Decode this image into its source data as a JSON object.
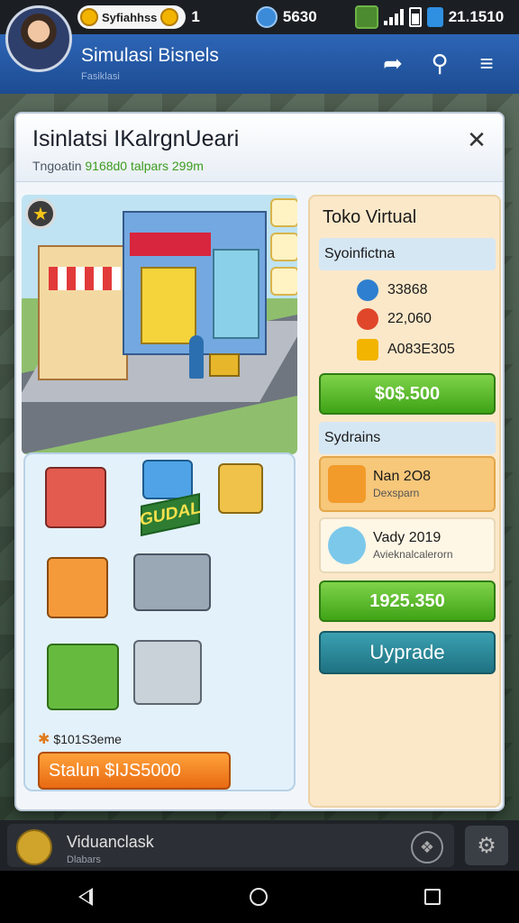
{
  "status_bar": {
    "chip_label": "Syfiahhss",
    "chip_value": "1",
    "gem_value": "5630",
    "time": "21.1510"
  },
  "app_bar": {
    "title": "Simulasi Bisnels",
    "subtitle": "Fasiklasi"
  },
  "modal": {
    "title": "Isinlatsi IKalrgnUeari",
    "subtitle_prefix": "Tngoatin ",
    "subtitle_highlight": "9168d0 talpars 299m",
    "items_panel": {
      "sign_label": "GUDAL",
      "note": "$101S3eme",
      "start_button": "Stalun $IJS5000"
    },
    "info_panel": {
      "title": "Toko Virtual",
      "section1": "Syoinfictna",
      "stats": [
        {
          "value": "33868",
          "icon": "clock-icon",
          "color": "#2f7fd0"
        },
        {
          "value": "22,060",
          "icon": "no-entry-icon",
          "color": "#e0472a"
        },
        {
          "value": "A083E305",
          "icon": "stack-icon",
          "color": "#f2b400"
        }
      ],
      "buy_button": "$0$.500",
      "section2": "Sydrains",
      "cards": [
        {
          "title": "Nan 2O8",
          "sub": "Dexsparn",
          "icon": "upgrade-card-icon",
          "bg": "#f7c77a"
        },
        {
          "title": "Vady 2019",
          "sub": "Avieknalcalerorn",
          "icon": "lightbulb-icon",
          "bg": "#fff7e6"
        }
      ],
      "price_button": "1925.350",
      "upgrade_button": "Uyprade"
    }
  },
  "bottom_bar": {
    "title": "Viduanclask",
    "subtitle": "Dlabars"
  },
  "colors": {
    "header_blue": "#2d65b6",
    "green_button": "#3fa316",
    "orange_button": "#e86a12",
    "teal_button": "#1f7282"
  }
}
